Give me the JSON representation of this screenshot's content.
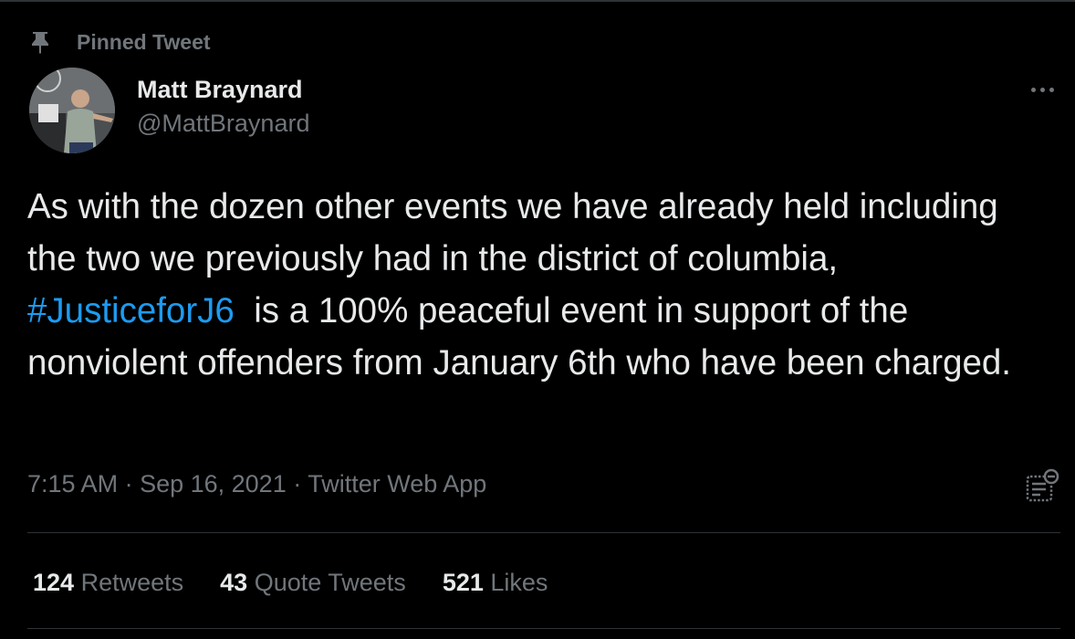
{
  "pinned": {
    "label": "Pinned Tweet",
    "icon": "pin-icon"
  },
  "author": {
    "display_name": "Matt Braynard",
    "handle": "@MattBraynard",
    "avatar_icon": "avatar"
  },
  "more_icon": "more-horizontal-icon",
  "tweet": {
    "text_before": "As with the dozen other events we have already held including the two we previously had in the district of columbia, ",
    "hashtag": "#JusticeforJ6",
    "text_after": "  is a 100% peaceful event in support of the nonviolent offenders from January 6th who have been charged."
  },
  "meta": {
    "time": "7:15 AM",
    "separator1": " · ",
    "date": "Sep 16, 2021",
    "separator2": " · ",
    "source": "Twitter Web App"
  },
  "activity_icon": "tweet-activity-icon",
  "stats": {
    "retweets_count": "124",
    "retweets_label": "Retweets",
    "quotes_count": "43",
    "quotes_label": "Quote Tweets",
    "likes_count": "521",
    "likes_label": "Likes"
  },
  "colors": {
    "background": "#000000",
    "text": "#e7e9ea",
    "secondary": "#71767b",
    "link": "#1d9bf0",
    "divider": "#2f3336"
  }
}
